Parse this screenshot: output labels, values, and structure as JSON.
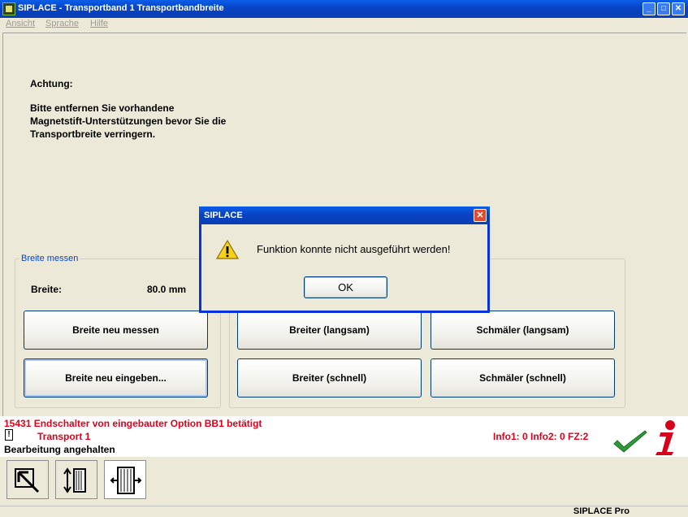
{
  "window": {
    "title": "SIPLACE - Transportband 1 Transportbandbreite",
    "minimize": "_",
    "maximize": "□",
    "close": "✕"
  },
  "menu": {
    "items": [
      "Ansicht",
      "Sprache",
      "Hilfe"
    ]
  },
  "warning": {
    "heading": "Achtung:",
    "lines": [
      "Bitte entfernen Sie vorhandene",
      "Magnetstift-Unterstützungen bevor Sie die",
      "Transportbreite verringern."
    ]
  },
  "measure_group": {
    "label": "Breite messen",
    "width_label": "Breite:",
    "width_value": "80.0   mm",
    "button_measure": "Breite neu messen",
    "button_enter": "Breite neu eingeben..."
  },
  "adjust_group": {
    "wider_slow": "Breiter (langsam)",
    "narrower_slow": "Schmäler (langsam)",
    "wider_fast": "Breiter (schnell)",
    "narrower_fast": "Schmäler (schnell)"
  },
  "status": {
    "error_message": "15431 Endschalter von eingebauter Option BB1 betätigt",
    "transport": "Transport 1",
    "state": "Bearbeitung angehalten",
    "info": "Info1:  0  Info2:  0  FZ:2",
    "check_icon": "checkmark-icon",
    "info_icon": "info-icon",
    "exclamation": "!"
  },
  "toolbar": {
    "tools": [
      "arrow-pointer-icon",
      "width-adjust-icon",
      "transport-width-icon"
    ]
  },
  "footer": {
    "product": "SIPLACE Pro"
  },
  "dialog": {
    "title": "SIPLACE",
    "close": "✕",
    "message": "Funktion konnte nicht ausgeführt werden!",
    "ok_label": "OK",
    "icon": "warning-icon"
  },
  "colors": {
    "titlebar": "#0a4fd8",
    "error_text": "#e0001b",
    "group_label": "#0046d5",
    "background": "#ece9d8"
  }
}
